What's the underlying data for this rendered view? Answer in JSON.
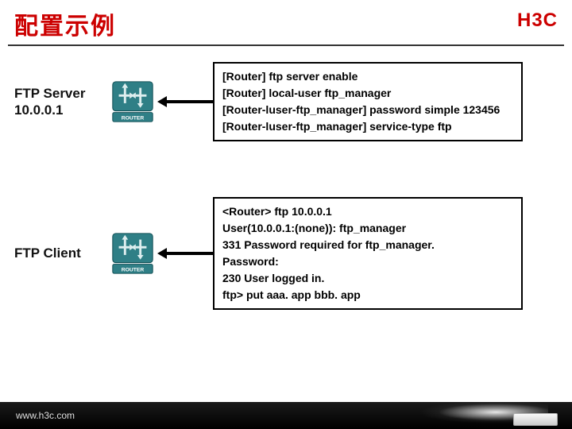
{
  "header": {
    "title": "配置示例",
    "logo": "H3C"
  },
  "server": {
    "label_line1": "FTP Server",
    "label_line2": "10.0.0.1",
    "router_caption": "ROUTER",
    "config": "[Router] ftp server enable\n[Router] local-user ftp_manager\n[Router-luser-ftp_manager] password simple 123456\n[Router-luser-ftp_manager] service-type ftp"
  },
  "client": {
    "label_line1": "FTP Client",
    "router_caption": "ROUTER",
    "config": "<Router> ftp 10.0.0.1\nUser(10.0.0.1:(none)): ftp_manager\n331 Password required for ftp_manager.\nPassword:\n230 User logged in.\nftp> put aaa. app bbb. app"
  },
  "footer": {
    "url": "www.h3c.com"
  },
  "colors": {
    "brand_red": "#c00",
    "router_teal": "#2f7f86"
  }
}
